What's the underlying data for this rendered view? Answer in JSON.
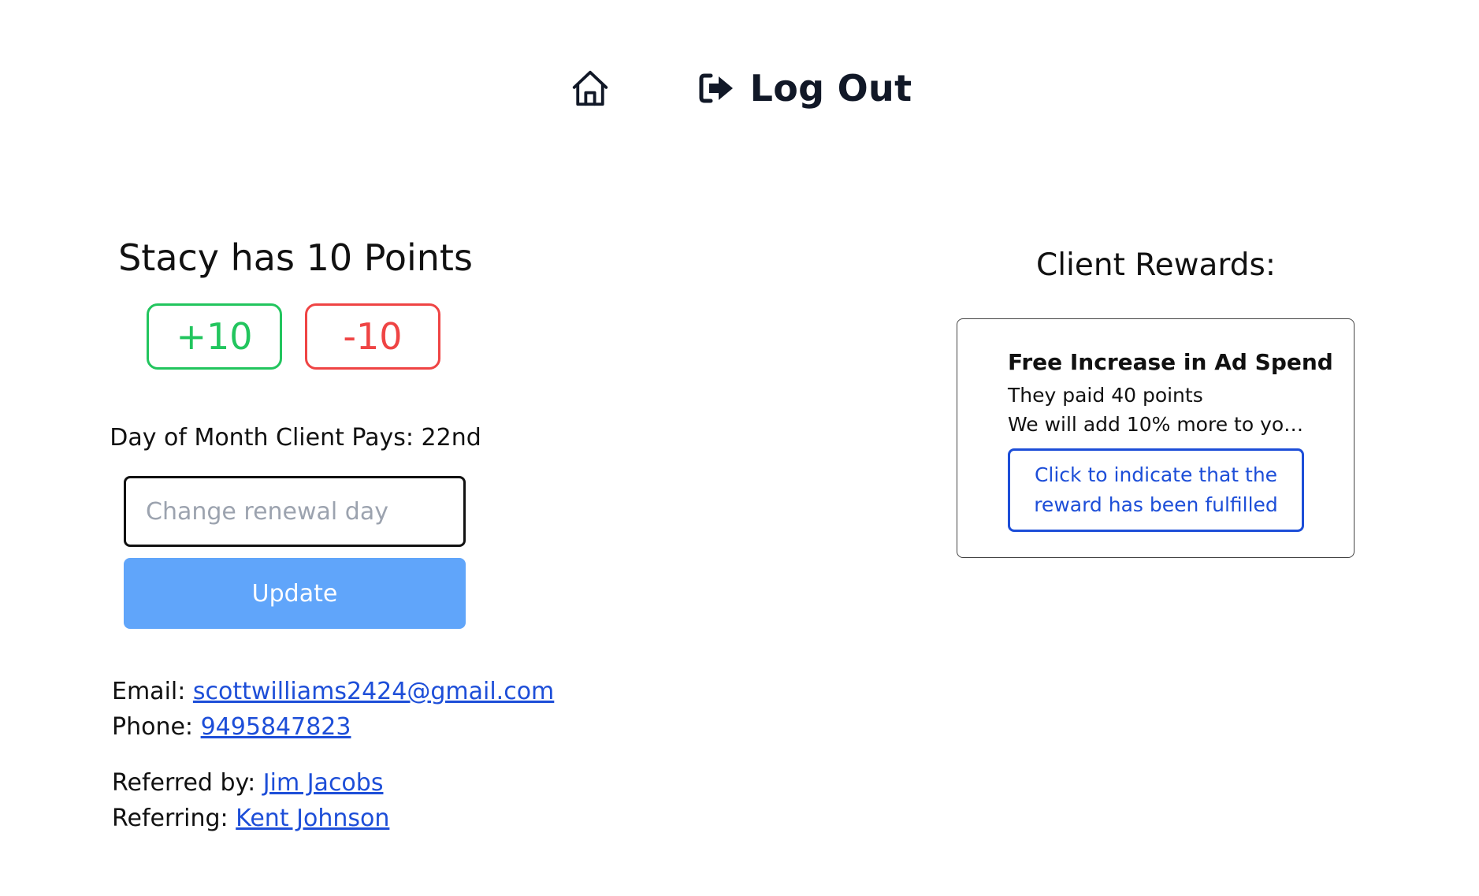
{
  "nav": {
    "home_icon": "home-icon",
    "logout_icon": "logout-arrow-icon",
    "logout_label": "Log Out"
  },
  "client": {
    "points_title": "Stacy has 10 Points",
    "plus_label": "+10",
    "minus_label": "-10",
    "pay_day_text": "Day of Month Client Pays: 22nd",
    "renewal_placeholder": "Change renewal day",
    "renewal_value": "",
    "update_label": "Update"
  },
  "contact": {
    "email_label": "Email:",
    "email": "scottwilliams2424@gmail.com",
    "phone_label": "Phone:",
    "phone": "9495847823",
    "referred_by_label": "Referred by:",
    "referred_by": "Jim Jacobs",
    "referring_label": "Referring:",
    "referring": "Kent Johnson"
  },
  "rewards": {
    "title": "Client Rewards:",
    "items": [
      {
        "name": "Free Increase in Ad Spend",
        "cost": "They paid 40 points",
        "description": "We will add 10% more to your ...",
        "fulfill_label": "Click to indicate that the reward has been fulfilled"
      }
    ]
  },
  "colors": {
    "plus": "#22c55e",
    "minus": "#ef4444",
    "update_button": "#60a5fa",
    "link": "#1d4ed8"
  }
}
